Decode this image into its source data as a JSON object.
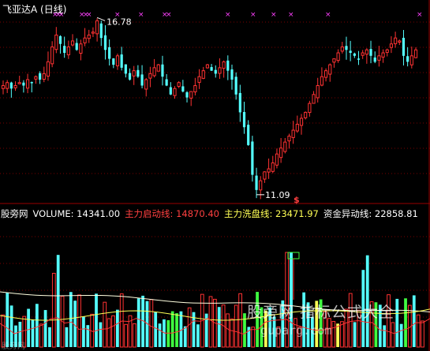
{
  "header": {
    "title": "飞亚达A (日线)"
  },
  "volume_header": {
    "source": "股旁网",
    "volume_label": "VOLUME: 14341.00",
    "startup_label": "主力启动线: 14870.40",
    "wash_label": "主力洗盘线: 23471.97",
    "anomaly_label": "资金异动线: 22858.81"
  },
  "annotations": {
    "high_label": "16.78",
    "low_label": "11.09",
    "signal_label": "$"
  },
  "watermark": {
    "text": "股旁网  指标公式大全",
    "url": "guparg.com",
    "corner": "股旁网"
  },
  "chart_data": [
    {
      "type": "candlestick",
      "title": "飞亚达A (日线)",
      "high": 16.78,
      "low": 11.09,
      "closes": [
        14.6,
        14.7,
        14.5,
        14.6,
        14.7,
        14.6,
        14.8,
        14.7,
        14.9,
        14.8,
        15.0,
        15.4,
        15.9,
        16.3,
        16.0,
        15.7,
        15.9,
        16.1,
        15.8,
        16.0,
        16.2,
        16.3,
        16.4,
        16.78,
        16.2,
        15.8,
        15.5,
        15.3,
        15.6,
        15.2,
        15.0,
        14.8,
        15.1,
        14.9,
        14.6,
        14.8,
        15.0,
        15.2,
        15.3,
        14.9,
        14.6,
        14.3,
        14.5,
        14.7,
        14.4,
        14.2,
        14.4,
        14.6,
        14.9,
        15.1,
        15.3,
        15.1,
        15.0,
        15.2,
        15.4,
        15.1,
        14.8,
        14.3,
        13.7,
        13.2,
        12.6,
        11.6,
        11.09,
        11.4,
        11.7,
        11.8,
        12.0,
        12.3,
        12.5,
        12.7,
        12.9,
        13.1,
        13.3,
        13.5,
        13.7,
        14.0,
        14.3,
        14.6,
        14.9,
        15.1,
        15.3,
        15.5,
        15.7,
        15.9,
        15.8,
        15.7,
        15.6,
        15.5,
        15.7,
        15.8,
        15.6,
        15.4,
        15.6,
        15.7,
        15.8,
        16.0,
        16.2,
        16.1,
        15.6,
        15.4,
        15.6,
        15.8
      ],
      "markers": "magenta x symbols along top edge",
      "grid": true
    },
    {
      "type": "bar",
      "title": "VOLUME",
      "series": [
        {
          "name": "VOLUME",
          "values": [
            14341.0
          ]
        },
        {
          "name": "主力启动线",
          "values": [
            14870.4
          ]
        },
        {
          "name": "主力洗盘线",
          "values": [
            23471.97
          ]
        },
        {
          "name": "资金异动线",
          "values": [
            22858.81
          ]
        }
      ]
    }
  ]
}
